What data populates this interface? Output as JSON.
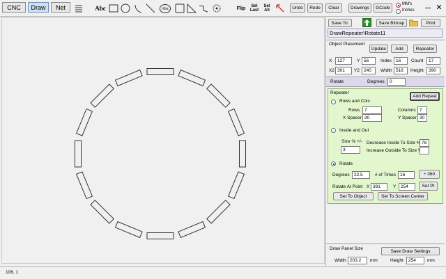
{
  "toolbar": {
    "tabs": [
      {
        "label": "CNC"
      },
      {
        "label": "Draw"
      },
      {
        "label": "Net"
      }
    ],
    "text_tool": "Abc",
    "circle_text_tool": "Abc",
    "flip": "Flip",
    "sel_last": "Sel Last",
    "sel_all": "Sel All",
    "undo": "Undo",
    "redo": "Redo",
    "clear": "Clear",
    "drawings": "Drawings",
    "gcode": "GCode",
    "mms": "MM's",
    "inches": "Inches"
  },
  "panel": {
    "save_to": "Save To:",
    "save_bitmap": "Save Bitmap",
    "print": "Print",
    "file_name": "DrawRepeater\\Rotate11",
    "object_placement": {
      "title": "Object Placement",
      "update": "Update",
      "add": "Add",
      "repeater": "Repeater",
      "x_label": "X",
      "x": "127",
      "y_label": "Y",
      "y": "56",
      "index_label": "Index",
      "index": "16",
      "count_label": "Count",
      "count": "17",
      "x2_label": "X2",
      "x2": "301",
      "y2_label": "Y2",
      "y2": "240",
      "width_label": "Width",
      "width": "516",
      "height_label": "Height",
      "height": "390"
    },
    "rotate": {
      "label": "Rotate",
      "degrees_label": "Degrees",
      "degrees": "0"
    },
    "repeater": {
      "title": "Repeater",
      "add_repeat": "Add Repeat",
      "rows_and_cols": "Rows and Cols",
      "rows_label": "Rows",
      "rows": "7",
      "columns_label": "Columns",
      "columns": "7",
      "x_spacer_label": "X Spacer",
      "x_spacer": "30",
      "y_spacer_label": "Y Spacer",
      "y_spacer": "30",
      "inside_and_out": "Inside and Out",
      "size_label": "Size % +/-",
      "size": "3",
      "decrease_label": "Decrease Inside To Size %",
      "decrease": "78",
      "increase_label": "Increase Outside To Size %",
      "increase": "",
      "rotate_option": "Rotate",
      "degrees_label": "Degrees",
      "degrees": "22.5",
      "times_label": "# of Times",
      "times": "16",
      "div360": "÷ 360",
      "rotate_at_point_label": "Rotate At Point",
      "px_label": "X",
      "px": "391",
      "py_label": "Y",
      "py": "254",
      "set_pt": "Set Pt",
      "set_to_object": "Set To Object",
      "set_to_screen_center": "Set To Screen Center"
    },
    "draw_panel": {
      "title": "Draw Panel Size",
      "save_settings": "Save Draw Settings",
      "width_label": "Width",
      "width": "203.2",
      "width_unit": "mm",
      "height_label": "Height",
      "height": "254",
      "height_unit": "mm"
    }
  },
  "canvas": {
    "ring": {
      "count": 16,
      "step_degrees": 22.5
    }
  },
  "status": {
    "coords": "106, 1"
  }
}
